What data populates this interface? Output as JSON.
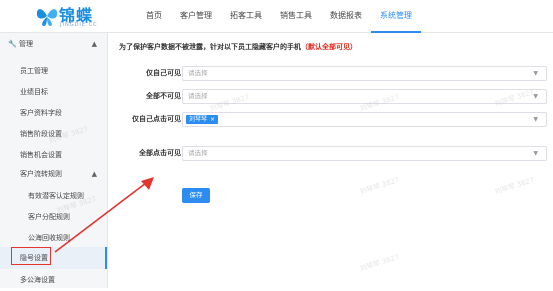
{
  "logo": {
    "name": "锦蝶",
    "sub": "JINGDIE.CC"
  },
  "nav": [
    "首页",
    "客户管理",
    "拓客工具",
    "销售工具",
    "数据报表",
    "系统管理"
  ],
  "sidebar": {
    "section": "管理",
    "items": [
      "员工管理",
      "业绩目标",
      "客户资料字段",
      "销售阶段设置",
      "销售机会设置",
      "客户流转规则",
      "有效潜客认定规则",
      "客户分配规则",
      "公海回收规则",
      "隐号设置",
      "多公海设置"
    ]
  },
  "main": {
    "notice": "为了保护客户数据不被泄露，针对以下员工隐藏客户的手机",
    "notice_red": "（默认全部可见）",
    "fields": [
      {
        "label": "仅自己可见",
        "placeholder": "请选择"
      },
      {
        "label": "全部不可见",
        "placeholder": "请选择"
      },
      {
        "label": "仅自己点击可见",
        "tag": "刘琴琴",
        "tag_close": "×"
      },
      {
        "label": "全部点击可见",
        "placeholder": "请选择"
      }
    ],
    "save": "保存",
    "watermark": "刘琴琴 3827"
  }
}
